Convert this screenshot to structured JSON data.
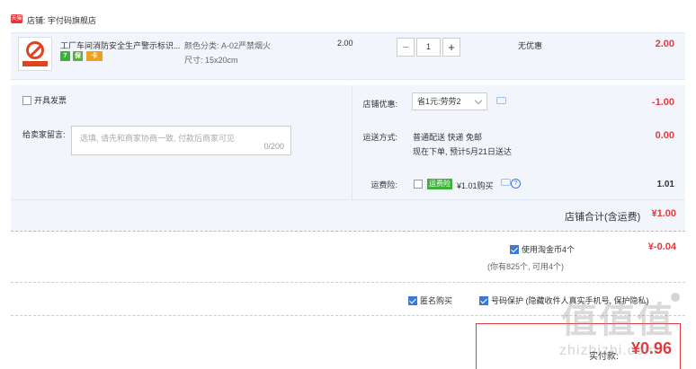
{
  "shop": {
    "badge": "天猫",
    "name": "店铺: 宇付码旗舰店"
  },
  "item": {
    "title": "工厂车间消防安全生产警示标识...",
    "tags": [
      "7",
      "保",
      "卡"
    ],
    "sku_color": "颜色分类: A-02严禁烟火",
    "sku_size": "尺寸: 15x20cm",
    "unit_price": "2.00",
    "qty": "1",
    "qty_minus": "−",
    "qty_plus": "+",
    "discount_text": "无优惠",
    "line_total": "2.00"
  },
  "order": {
    "invoice_label": "开具发票",
    "message_label": "给卖家留言:",
    "message_placeholder": "选填, 请先和商家协商一致, 付款后商家可见",
    "message_count": "0/200",
    "coupon_label": "店铺优惠:",
    "coupon_value": "省1元:劳劳2",
    "coupon_amount": "-1.00",
    "shipping_label": "运送方式:",
    "shipping_line1": "普通配送 快递 免邮",
    "shipping_line2": "现在下单, 预计5月21日送达",
    "shipping_amount": "0.00",
    "insurance_label": "运费险:",
    "insurance_badge": "运费险",
    "insurance_text": "¥1.01购买",
    "insurance_amount": "1.01",
    "subtotal_label": "店铺合计(含运费)",
    "subtotal_value": "¥1.00"
  },
  "coins": {
    "use_label": "使用淘金币4个",
    "amount": "¥-0.04",
    "note": "(你有825个, 可用4个)"
  },
  "options": {
    "anonymous": "匿名购买",
    "phone_protect": "号码保护 (隐藏收件人真实手机号, 保护隐私)"
  },
  "total": {
    "label": "实付款:",
    "value": "¥0.96"
  },
  "watermark": {
    "glyphs": "值值值",
    "url": "zhizhizhi.com"
  },
  "colors": {
    "accent": "#e4393c",
    "panel": "#f2f6fc",
    "brand_blue": "#3d7ad6"
  }
}
